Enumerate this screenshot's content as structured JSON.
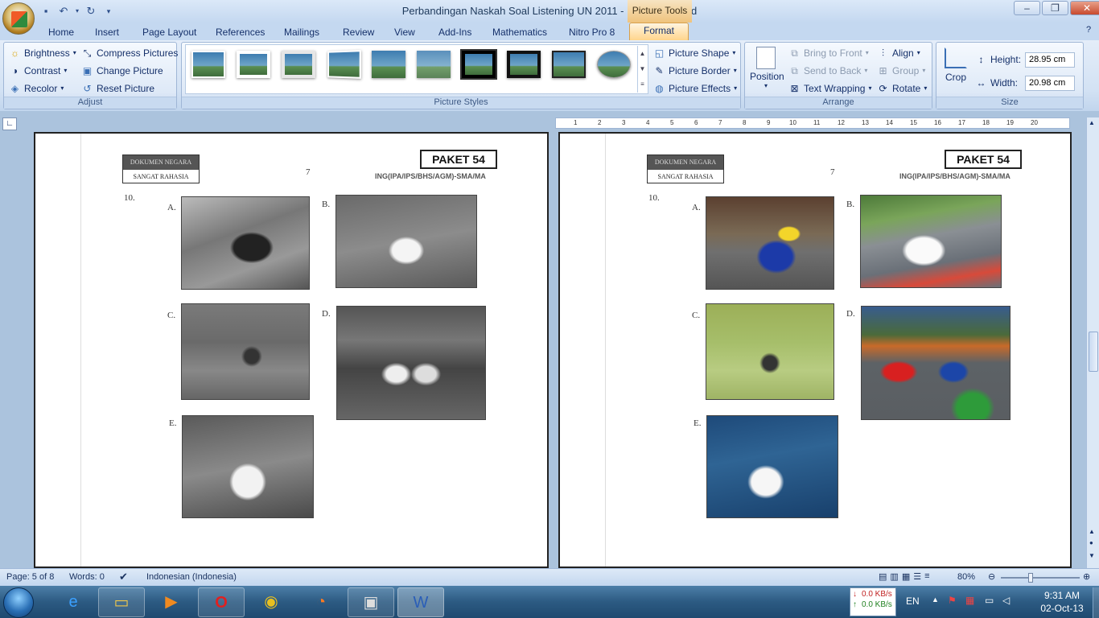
{
  "window": {
    "title": "Perbandingan Naskah Soal Listening UN 2011 - Microsoft Word",
    "context_tab": "Picture Tools"
  },
  "qat": {
    "icons": [
      "save-icon",
      "undo-icon",
      "redo-icon",
      "customize-icon"
    ]
  },
  "tabs": [
    "Home",
    "Insert",
    "Page Layout",
    "References",
    "Mailings",
    "Review",
    "View",
    "Add-Ins",
    "Mathematics",
    "Nitro Pro 8",
    "Format"
  ],
  "ribbon": {
    "adjust": {
      "label": "Adjust",
      "brightness": "Brightness",
      "contrast": "Contrast",
      "recolor": "Recolor",
      "compress": "Compress Pictures",
      "change": "Change Picture",
      "reset": "Reset Picture"
    },
    "styles": {
      "label": "Picture Styles",
      "shape": "Picture Shape",
      "border": "Picture Border",
      "effects": "Picture Effects"
    },
    "arrange": {
      "label": "Arrange",
      "position": "Position",
      "bring_front": "Bring to Front",
      "send_back": "Send to Back",
      "text_wrapping": "Text Wrapping",
      "align": "Align",
      "group": "Group",
      "rotate": "Rotate"
    },
    "size": {
      "label": "Size",
      "crop": "Crop",
      "height_label": "Height:",
      "height_value": "28.95 cm",
      "width_label": "Width:",
      "width_value": "20.98 cm"
    }
  },
  "ruler": {
    "marks": [
      "1",
      "2",
      "3",
      "4",
      "5",
      "6",
      "7",
      "8",
      "9",
      "10",
      "11",
      "12",
      "13",
      "14",
      "15",
      "16",
      "17",
      "18",
      "19",
      "20"
    ]
  },
  "pages": [
    {
      "stamp_top": "DOKUMEN NEGARA",
      "stamp_bottom": "SANGAT RAHASIA",
      "page_number": "7",
      "paket": "PAKET 54",
      "subject": "ING(IPA/IPS/BHS/AGM)-SMA/MA",
      "question": "10.",
      "options": [
        "A.",
        "B.",
        "C.",
        "D.",
        "E."
      ]
    },
    {
      "stamp_top": "DOKUMEN NEGARA",
      "stamp_bottom": "SANGAT RAHASIA",
      "page_number": "7",
      "paket": "PAKET 54",
      "subject": "ING(IPA/IPS/BHS/AGM)-SMA/MA",
      "question": "10.",
      "options": [
        "A.",
        "B.",
        "C.",
        "D.",
        "E."
      ]
    }
  ],
  "status": {
    "page": "Page: 5 of 8",
    "words": "Words: 0",
    "language": "Indonesian (Indonesia)",
    "zoom": "80%"
  },
  "taskbar": {
    "net_down": "0.0 KB/s",
    "net_up": "0.0 KB/s",
    "lang": "EN",
    "time": "9:31 AM",
    "date": "02-Oct-13"
  }
}
